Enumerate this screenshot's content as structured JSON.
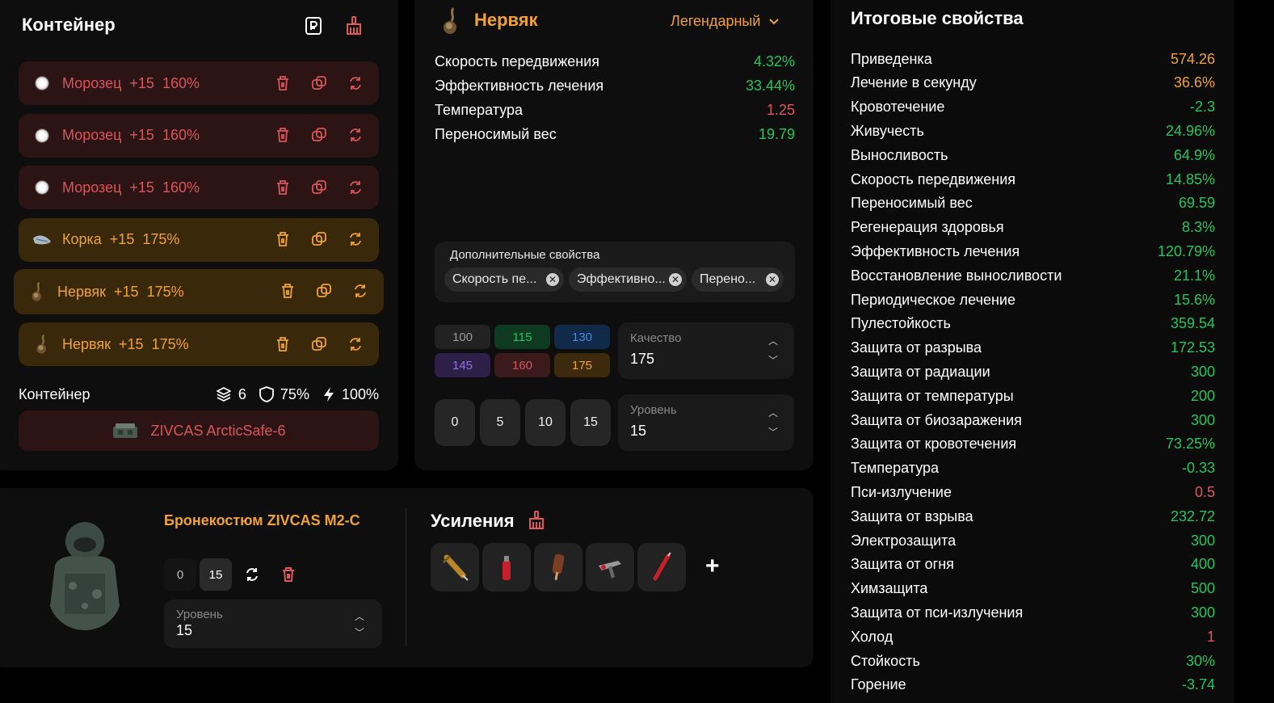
{
  "container": {
    "title": "Контейнер",
    "artifacts": [
      {
        "name": "Морозец",
        "level": "+15",
        "quality": "160%",
        "rarity": "red",
        "icon": "frost-artifact-icon"
      },
      {
        "name": "Морозец",
        "level": "+15",
        "quality": "160%",
        "rarity": "red",
        "icon": "frost-artifact-icon"
      },
      {
        "name": "Морозец",
        "level": "+15",
        "quality": "160%",
        "rarity": "red",
        "icon": "frost-artifact-icon"
      },
      {
        "name": "Корка",
        "level": "+15",
        "quality": "175%",
        "rarity": "gold",
        "icon": "crust-artifact-icon"
      },
      {
        "name": "Нервяк",
        "level": "+15",
        "quality": "175%",
        "rarity": "gold",
        "icon": "nerve-artifact-icon"
      },
      {
        "name": "Нервяк",
        "level": "+15",
        "quality": "175%",
        "rarity": "gold",
        "icon": "nerve-artifact-icon"
      }
    ],
    "summary_label": "Контейнер",
    "slots": "6",
    "protection": "75%",
    "efficiency": "100%",
    "case_name": "ZIVCAS ArcticSafe-6"
  },
  "artifact": {
    "name": "Нервяк",
    "rarity": "Легендарный",
    "properties": [
      {
        "label": "Скорость передвижения",
        "value": "4.32%",
        "tone": "green"
      },
      {
        "label": "Эффективность лечения",
        "value": "33.44%",
        "tone": "green"
      },
      {
        "label": "Температура",
        "value": "1.25",
        "tone": "red"
      },
      {
        "label": "Переносимый вес",
        "value": "19.79",
        "tone": "green"
      }
    ],
    "extra_title": "Дополнительные свойства",
    "extra_chips": [
      "Скорость пе...",
      "Эффективно...",
      "Перено..."
    ],
    "quality_options": [
      {
        "label": "100",
        "bg": "#222222",
        "fg": "#9a9a9a"
      },
      {
        "label": "115",
        "bg": "#0f3a22",
        "fg": "#22c55e"
      },
      {
        "label": "130",
        "bg": "#112a4a",
        "fg": "#4a8bdc"
      },
      {
        "label": "145",
        "bg": "#2d1f47",
        "fg": "#9b6fe0"
      },
      {
        "label": "160",
        "bg": "#3a1a1b",
        "fg": "#d9555a"
      },
      {
        "label": "175",
        "bg": "#3d2a0c",
        "fg": "#f2a235"
      }
    ],
    "quality_label": "Качество",
    "quality_value": "175",
    "level_buttons": [
      "0",
      "5",
      "10",
      "15"
    ],
    "level_label": "Уровень",
    "level_value": "15"
  },
  "armor": {
    "name": "Бронекостюм ZIVCAS M2-C",
    "upgrade_buttons": [
      "0",
      "15"
    ],
    "level_label": "Уровень",
    "level_value": "15",
    "boosts_title": "Усиления",
    "add_label": "+"
  },
  "totals": {
    "title": "Итоговые свойства",
    "rows": [
      {
        "label": "Приведенка",
        "value": "574.26",
        "tone": "orange"
      },
      {
        "label": "Лечение в секунду",
        "value": "36.6%",
        "tone": "orange"
      },
      {
        "label": "Кровотечение",
        "value": "-2.3",
        "tone": "green"
      },
      {
        "label": "Живучесть",
        "value": "24.96%",
        "tone": "green"
      },
      {
        "label": "Выносливость",
        "value": "64.9%",
        "tone": "green"
      },
      {
        "label": "Скорость передвижения",
        "value": "14.85%",
        "tone": "green"
      },
      {
        "label": "Переносимый вес",
        "value": "69.59",
        "tone": "green"
      },
      {
        "label": "Регенерация здоровья",
        "value": "8.3%",
        "tone": "green"
      },
      {
        "label": "Эффективность лечения",
        "value": "120.79%",
        "tone": "green"
      },
      {
        "label": "Восстановление выносливости",
        "value": "21.1%",
        "tone": "green"
      },
      {
        "label": "Периодическое лечение",
        "value": "15.6%",
        "tone": "green"
      },
      {
        "label": "Пулестойкость",
        "value": "359.54",
        "tone": "green"
      },
      {
        "label": "Защита от разрыва",
        "value": "172.53",
        "tone": "green"
      },
      {
        "label": "Защита от радиации",
        "value": "300",
        "tone": "green"
      },
      {
        "label": "Защита от температуры",
        "value": "200",
        "tone": "green"
      },
      {
        "label": "Защита от биозаражения",
        "value": "300",
        "tone": "green"
      },
      {
        "label": "Защита от кровотечения",
        "value": "73.25%",
        "tone": "green"
      },
      {
        "label": "Температура",
        "value": "-0.33",
        "tone": "green"
      },
      {
        "label": "Пси-излучение",
        "value": "0.5",
        "tone": "red"
      },
      {
        "label": "Защита от взрыва",
        "value": "232.72",
        "tone": "green"
      },
      {
        "label": "Электрозащита",
        "value": "300",
        "tone": "green"
      },
      {
        "label": "Защита от огня",
        "value": "400",
        "tone": "green"
      },
      {
        "label": "Химзащита",
        "value": "500",
        "tone": "green"
      },
      {
        "label": "Защита от пси-излучения",
        "value": "300",
        "tone": "green"
      },
      {
        "label": "Холод",
        "value": "1",
        "tone": "red"
      },
      {
        "label": "Стойкость",
        "value": "30%",
        "tone": "green"
      },
      {
        "label": "Горение",
        "value": "-3.74",
        "tone": "green"
      }
    ]
  }
}
